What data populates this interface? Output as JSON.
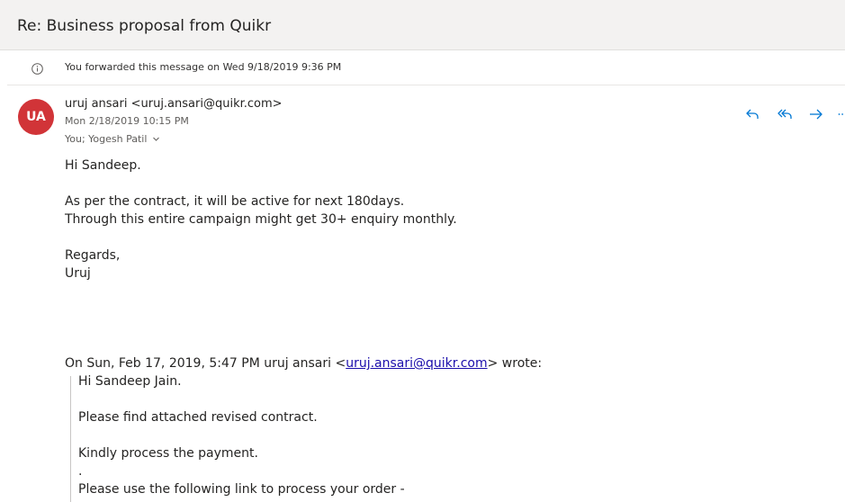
{
  "subject": "Re: Business proposal from Quikr",
  "info": {
    "icon": "info-icon",
    "text": "You forwarded this message on Wed 9/18/2019 9:36 PM"
  },
  "message": {
    "avatar_initials": "UA",
    "avatar_color": "#d13438",
    "sender": "uruj ansari <uruj.ansari@quikr.com>",
    "date": "Mon 2/18/2019 10:15 PM",
    "recipients": "You; Yogesh Patil",
    "actions": [
      "reply-icon",
      "reply-all-icon",
      "forward-icon",
      "more-icon"
    ],
    "body": {
      "greeting": "Hi Sandeep.",
      "line1": "As per the contract, it will be active for next 180days.",
      "line2": "Through this entire campaign might get 30+ enquiry monthly.",
      "regards": "Regards,",
      "signature": "Uruj"
    },
    "quote": {
      "header_prefix": "On Sun, Feb 17, 2019, 5:47 PM uruj ansari <",
      "header_email": "uruj.ansari@quikr.com",
      "header_suffix": "> wrote:",
      "lines": [
        "Hi Sandeep Jain.",
        "Please find attached revised contract.",
        "Kindly process the payment.",
        ".",
        "Please use the following link to process your order -"
      ]
    }
  },
  "colors": {
    "accent": "#0078d4",
    "link": "#1a0dab",
    "subject_bar": "#f3f2f1"
  }
}
